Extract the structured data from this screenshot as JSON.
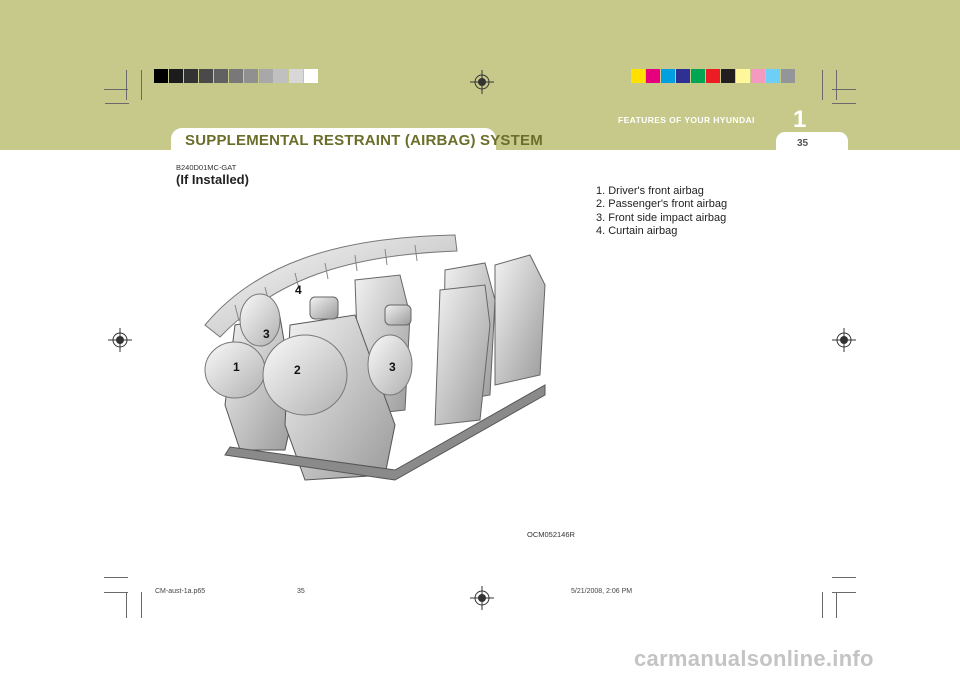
{
  "header": {
    "section_title": "SUPPLEMENTAL RESTRAINT (AIRBAG) SYSTEM",
    "chapter_number": "1",
    "chapter_name": "FEATURES OF YOUR HYUNDAI",
    "page_number": "35",
    "band_color": "#c6c98a"
  },
  "swatches": {
    "grayscale": [
      "#000000",
      "#1c1c1c",
      "#333333",
      "#4a4a4a",
      "#616161",
      "#787878",
      "#909090",
      "#a8a8a8",
      "#c0c0c0",
      "#d8d8d8",
      "#ffffff"
    ],
    "color": [
      "#ffe000",
      "#e6007e",
      "#00a0e0",
      "#2e3192",
      "#00a651",
      "#ed1c24",
      "#231f20",
      "#fff799",
      "#f49ac1",
      "#6dcff6",
      "#939598"
    ]
  },
  "content": {
    "code": "B240D01MC-GAT",
    "subtitle": "(If Installed)",
    "legend": [
      "1. Driver's front airbag",
      "2. Passenger's front airbag",
      "3. Front side impact airbag",
      "4. Curtain airbag"
    ]
  },
  "figure": {
    "labels": [
      "1",
      "2",
      "3",
      "3",
      "4"
    ],
    "code": "OCM052146R"
  },
  "footer": {
    "file": "CM-aust-1a.p65",
    "page": "35",
    "date": "5/21/2008, 2:06 PM"
  },
  "watermark": "carmanualsonline.info"
}
